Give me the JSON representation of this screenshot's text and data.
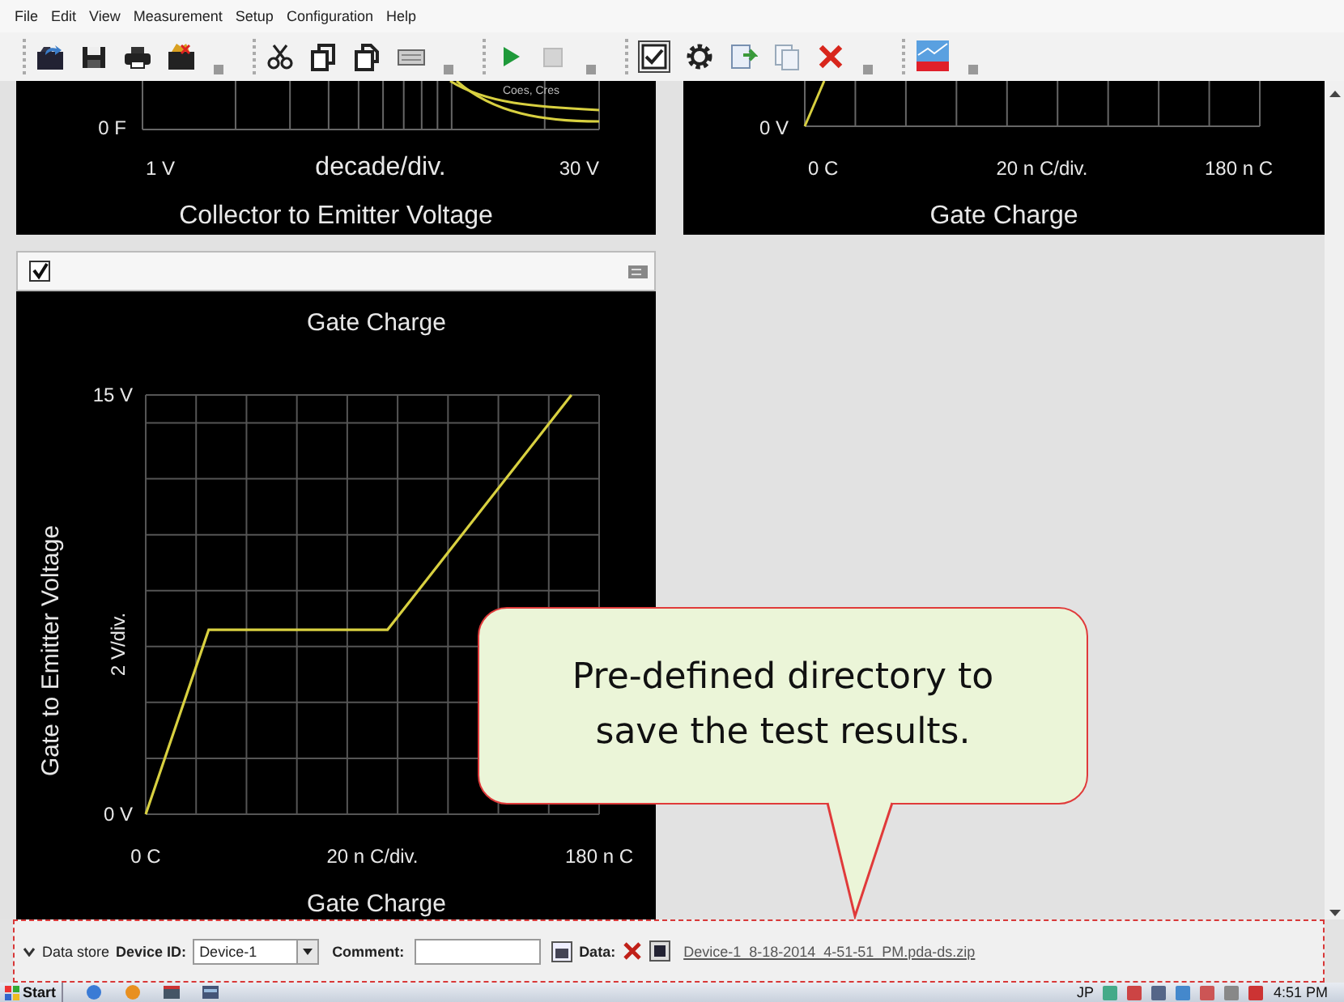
{
  "menu": [
    "File",
    "Edit",
    "View",
    "Measurement",
    "Setup",
    "Configuration",
    "Help"
  ],
  "panels": [
    {
      "kind": "log",
      "y_tick": "0 F",
      "legend": "Coes, Cres",
      "x_min": "1 V",
      "x_scale": "decade/div.",
      "x_max": "30 V",
      "title": "Collector to Emitter Voltage"
    },
    {
      "kind": "linear",
      "y_tick": "0 V",
      "x_min": "0 C",
      "x_scale": "20 n C/div.",
      "x_max": "180 n C",
      "title": "Gate Charge"
    }
  ],
  "gate_charge_panel": {
    "checked": true,
    "y_scale": "2 V/div.",
    "x_scale": "20 n C/div.",
    "chart_data": {
      "type": "line",
      "title": "Gate Charge",
      "xlabel": "Gate Charge",
      "ylabel": "Gate to Emitter Voltage",
      "x": [
        0,
        25,
        96,
        169
      ],
      "series": [
        {
          "color": "#d8d040",
          "values": [
            0,
            6.6,
            6.6,
            15
          ]
        }
      ],
      "xlim": [
        0,
        180
      ],
      "ylim": [
        0,
        15
      ],
      "xticks": [
        {
          "value": 0,
          "label": "0 C"
        },
        {
          "value": 180,
          "label": "180 n C"
        }
      ],
      "yticks": [
        {
          "value": 0,
          "label": "0 V"
        },
        {
          "value": 15,
          "label": "15 V"
        }
      ]
    }
  },
  "data_store": {
    "expanded": true,
    "label": "Data store",
    "device_id_label": "Device ID:",
    "device_id": "Device-1",
    "comment_label": "Comment:",
    "data_label": "Data:",
    "file_link": "Device-1_8-18-2014_4-51-51_PM.pda-ds.zip"
  },
  "taskbar": {
    "start": "Start",
    "language": "JP",
    "time": "4:51 PM"
  },
  "callout": {
    "text": "Pre-defined directory to save the test results."
  }
}
